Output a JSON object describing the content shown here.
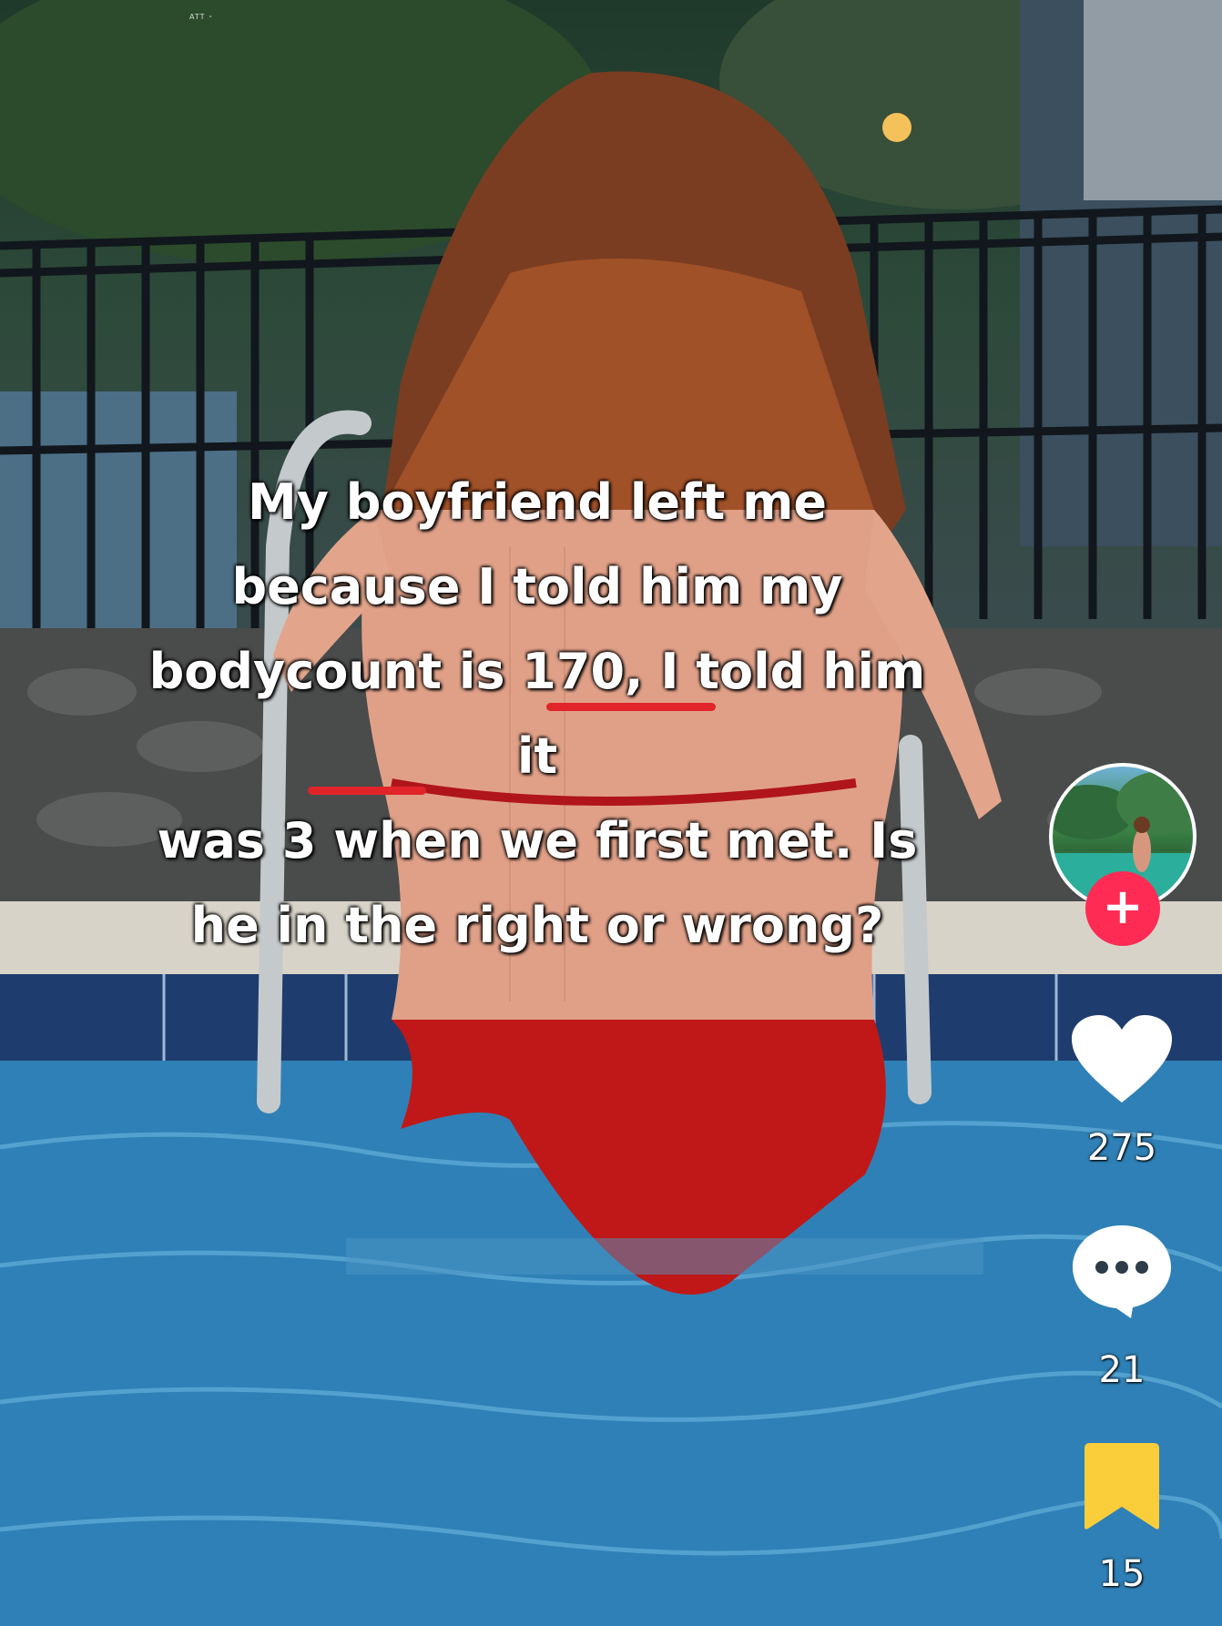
{
  "status_bar": {
    "text": "ATT ⁃"
  },
  "video": {
    "caption_lines": [
      "My boyfriend left me",
      "because I told him my",
      "bodycount is 170, I told him it",
      "was 3 when we first met. Is",
      "he in the right or wrong?"
    ]
  },
  "sidebar": {
    "follow_label": "+",
    "likes_count": "275",
    "comments_count": "21",
    "saves_count": "15"
  },
  "colors": {
    "follow": "#fe2c55",
    "underline": "#e1242a",
    "bookmark": "#facd3a",
    "icon": "#ffffff"
  }
}
